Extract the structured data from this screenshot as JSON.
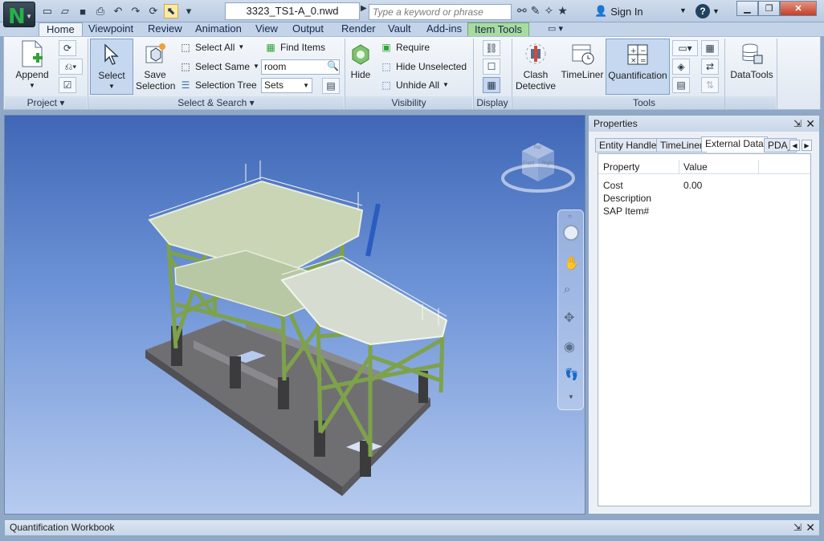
{
  "title_bar": {
    "document_title": "3323_TS1-A_0.nwd",
    "search_placeholder": "Type a keyword or phrase",
    "sign_in_label": "Sign In",
    "help_label": "?"
  },
  "ribbon_tabs": [
    "Home",
    "Viewpoint",
    "Review",
    "Animation",
    "View",
    "Output",
    "Render",
    "Vault",
    "Add-ins",
    "Item Tools"
  ],
  "ribbon": {
    "project": {
      "label": "Project",
      "append_label": "Append"
    },
    "select_search": {
      "label": "Select & Search",
      "select_label": "Select",
      "save_selection_label": "Save Selection",
      "select_all_label": "Select All",
      "select_same_label": "Select Same",
      "selection_tree_label": "Selection Tree",
      "find_items_label": "Find Items",
      "search_value": "room",
      "sets_label": "Sets"
    },
    "visibility": {
      "label": "Visibility",
      "hide_label": "Hide",
      "require_label": "Require",
      "hide_unselected_label": "Hide Unselected",
      "unhide_all_label": "Unhide All"
    },
    "display": {
      "label": "Display"
    },
    "tools": {
      "label": "Tools",
      "clash_detective_label": "Clash Detective",
      "timeliner_label": "TimeLiner",
      "quantification_label": "Quantification",
      "datatools_label": "DataTools"
    }
  },
  "viewcube": {
    "top_face": "Top",
    "left_face": "Front",
    "right_face": "Right"
  },
  "properties_panel": {
    "title": "Properties",
    "tabs": [
      "Entity Handle",
      "TimeLiner",
      "External Data",
      "PDA_"
    ],
    "active_tab": "External Data",
    "columns": [
      "Property",
      "Value"
    ],
    "rows": [
      {
        "property": "Cost",
        "value": "0.00"
      },
      {
        "property": "Description",
        "value": ""
      },
      {
        "property": "SAP Item#",
        "value": ""
      }
    ]
  },
  "bottom_panel": {
    "title": "Quantification Workbook"
  },
  "colors": {
    "steel_green": "#7ea24a",
    "base_grey": "#6f6f72",
    "sky_top": "#3f67b6",
    "selected_blue": "#c6d8ef",
    "close_red": "#c2402a"
  }
}
